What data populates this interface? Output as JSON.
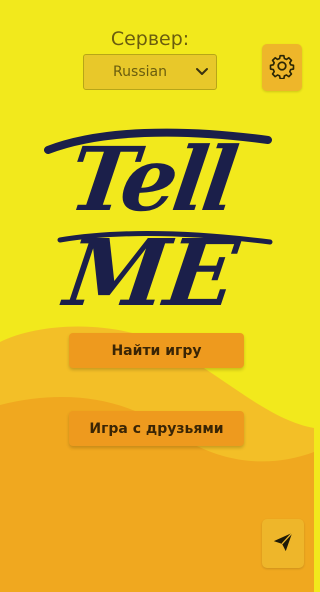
{
  "server": {
    "label": "Сервер:",
    "selected": "Russian"
  },
  "logo": {
    "line1": "Tell",
    "line2": "ME"
  },
  "buttons": {
    "find_game": "Найти игру",
    "play_with_friends": "Игра с друзьями"
  },
  "icons": {
    "settings": "gear-icon",
    "dropdown": "chevron-down-icon",
    "send": "paper-plane-icon"
  },
  "colors": {
    "background": "#f2e91c",
    "wave_light": "#f3bf27",
    "wave_dark": "#f0a81f",
    "button": "#ee9a1e",
    "icon_button": "#eeb62a",
    "logo_ink": "#1b1f4a"
  }
}
